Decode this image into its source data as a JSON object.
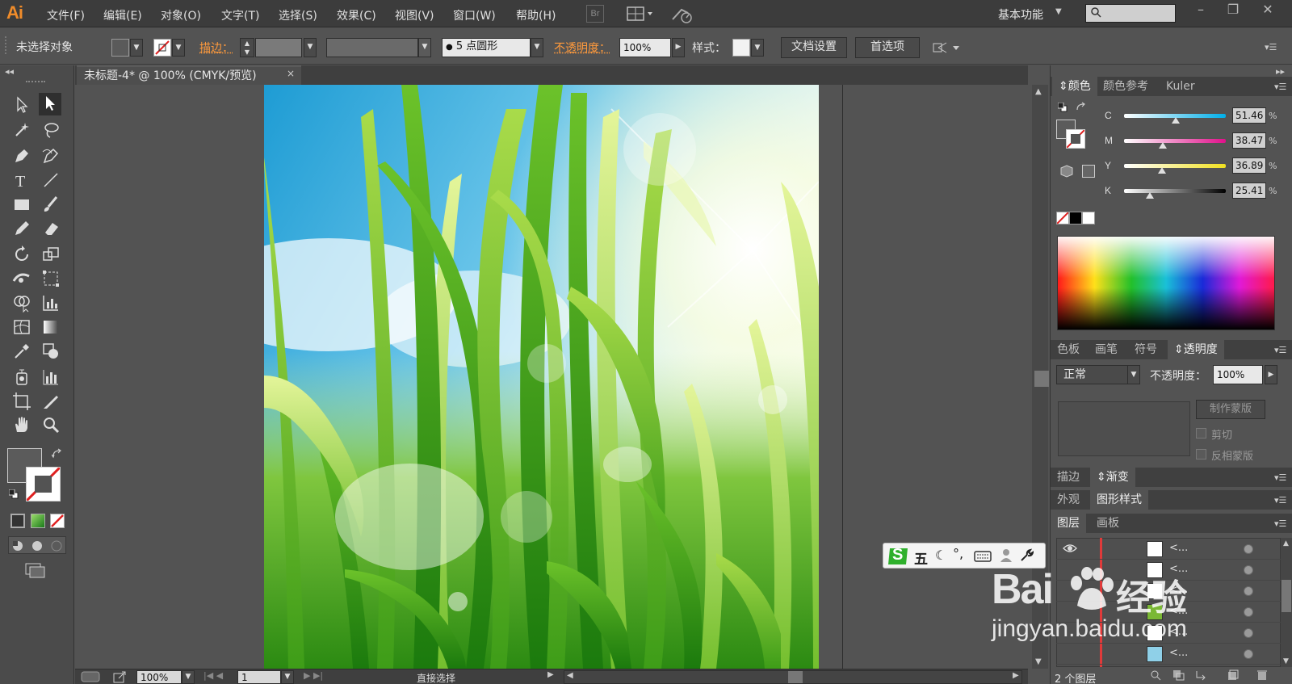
{
  "menubar": {
    "logo": "Ai",
    "items": [
      "文件(F)",
      "编辑(E)",
      "对象(O)",
      "文字(T)",
      "选择(S)",
      "效果(C)",
      "视图(V)",
      "窗口(W)",
      "帮助(H)"
    ],
    "bridge_badge": "Br",
    "workspace": "基本功能"
  },
  "controlbar": {
    "selection_status": "未选择对象",
    "stroke_label": "描边：",
    "brush_label": "5 点圆形",
    "opacity_label": "不透明度：",
    "opacity_value": "100%",
    "style_label": "样式：",
    "doc_setup_button": "文档设置",
    "preferences_button": "首选项"
  },
  "document": {
    "tab_title": "未标题-4* @ 100% (CMYK/预览)",
    "tab_close": "×"
  },
  "statusbar": {
    "zoom": "100%",
    "artboard_number": "1",
    "tool_status": "直接选择"
  },
  "color_panel": {
    "tabs": [
      "颜色",
      "颜色参考",
      "Kuler"
    ],
    "channels": [
      {
        "label": "C",
        "value": "51.46",
        "unit": "%",
        "level": 0.51
      },
      {
        "label": "M",
        "value": "38.47",
        "unit": "%",
        "level": 0.38
      },
      {
        "label": "Y",
        "value": "36.89",
        "unit": "%",
        "level": 0.37
      },
      {
        "label": "K",
        "value": "25.41",
        "unit": "%",
        "level": 0.25
      }
    ]
  },
  "transparency_panel": {
    "tabs": [
      "色板",
      "画笔",
      "符号",
      "透明度"
    ],
    "blend_mode": "正常",
    "opacity_label": "不透明度：",
    "opacity_value": "100%",
    "make_mask_button": "制作蒙版",
    "clip_label": "剪切",
    "invert_mask_label": "反相蒙版"
  },
  "stroke_gradient_panel": {
    "tabs": [
      "描边",
      "渐变"
    ]
  },
  "appearance_panel": {
    "tabs": [
      "外观",
      "图形样式"
    ]
  },
  "layers_panel": {
    "tabs": [
      "图层",
      "画板"
    ],
    "rows": [
      {
        "name": "<...",
        "thumb": "#ffffff",
        "visible": true
      },
      {
        "name": "<...",
        "thumb": "#ffffff",
        "visible": false
      },
      {
        "name": "<...",
        "thumb": "#ffffff",
        "visible": false
      },
      {
        "name": "<...",
        "thumb": "#7ab834",
        "visible": false
      },
      {
        "name": "<...",
        "thumb": "#ffffff",
        "visible": false
      },
      {
        "name": "<...",
        "thumb": "#8fd0e8",
        "visible": false
      }
    ],
    "footer_count": "2 个图层"
  },
  "ime_toolbar": {
    "logo": "S",
    "mode": "五"
  },
  "watermark": {
    "brand": "Bai",
    "brand_cn": "经验",
    "url": "jingyan.baidu.com"
  },
  "colors": {
    "accent_orange": "#f08c2a",
    "panel_bg": "#535353",
    "sky_blue": "#2aa8d6",
    "grass_green": "#3a9a1a"
  }
}
